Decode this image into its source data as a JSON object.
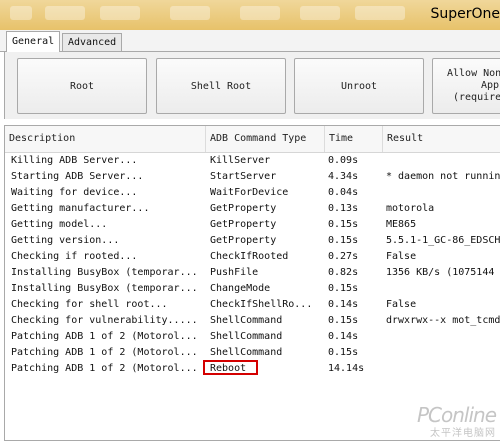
{
  "window": {
    "title": "SuperOne"
  },
  "tabs": [
    {
      "label": "General",
      "active": true
    },
    {
      "label": "Advanced",
      "active": false
    }
  ],
  "buttons": {
    "root": "Root",
    "shell_root": "Shell Root",
    "unroot": "Unroot",
    "allow_lines": [
      "Allow Non",
      "App",
      "(require"
    ]
  },
  "table": {
    "columns": [
      "Description",
      "ADB Command Type",
      "Time",
      "Result"
    ],
    "rows": [
      [
        "Killing ADB Server...",
        "KillServer",
        "0.09s",
        ""
      ],
      [
        "Starting ADB Server...",
        "StartServer",
        "4.34s",
        "* daemon not running"
      ],
      [
        "Waiting for device...",
        "WaitForDevice",
        "0.04s",
        ""
      ],
      [
        "Getting manufacturer...",
        "GetProperty",
        "0.13s",
        "motorola"
      ],
      [
        "Getting model...",
        "GetProperty",
        "0.15s",
        "ME865"
      ],
      [
        "Getting version...",
        "GetProperty",
        "0.15s",
        "5.5.1-1_GC-86_EDSCH"
      ],
      [
        "Checking if rooted...",
        "CheckIfRooted",
        "0.27s",
        "False"
      ],
      [
        "Installing BusyBox (temporar...",
        "PushFile",
        "0.82s",
        "1356 KB/s (1075144"
      ],
      [
        "Installing BusyBox (temporar...",
        "ChangeMode",
        "0.15s",
        ""
      ],
      [
        "Checking for shell root...",
        "CheckIfShellRo...",
        "0.14s",
        "False"
      ],
      [
        "Checking for vulnerability.....",
        "ShellCommand",
        "0.15s",
        "drwxrwx--x mot_tcmd"
      ],
      [
        "Patching ADB 1 of 2 (Motorol...",
        "ShellCommand",
        "0.14s",
        ""
      ],
      [
        "Patching ADB 1 of 2 (Motorol...",
        "ShellCommand",
        "0.15s",
        ""
      ],
      [
        "Patching ADB 1 of 2 (Motorol...",
        "Reboot",
        "14.14s",
        ""
      ]
    ],
    "highlight_color": "#d40000"
  },
  "watermark": {
    "main": "PConline",
    "sub": "太平洋电脑网"
  }
}
